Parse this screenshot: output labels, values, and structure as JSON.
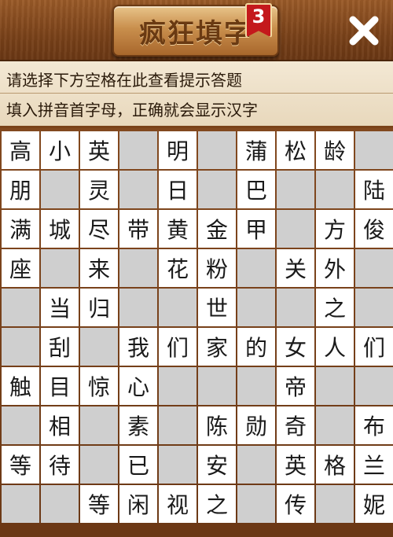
{
  "header": {
    "title": "疯狂填字",
    "level": "3",
    "close_icon": "close-icon"
  },
  "hints": {
    "line1": "请选择下方空格在此查看提示答题",
    "line2": "填入拼音首字母，正确就会显示汉字"
  },
  "grid": {
    "rows": [
      [
        "高",
        "小",
        "英",
        "#",
        "明",
        "#",
        "蒲",
        "松",
        "龄",
        "#"
      ],
      [
        "朋",
        "#",
        "灵",
        "#",
        "日",
        "#",
        "巴",
        "#",
        "#",
        "陆"
      ],
      [
        "满",
        "城",
        "尽",
        "带",
        "黄",
        "金",
        "甲",
        "#",
        "方",
        "俊"
      ],
      [
        "座",
        "#",
        "来",
        "#",
        "花",
        "粉",
        "#",
        "关",
        "外",
        "#"
      ],
      [
        "#",
        "当",
        "归",
        "#",
        "#",
        "世",
        "#",
        "#",
        "之",
        "#"
      ],
      [
        "#",
        "刮",
        "#",
        "我",
        "们",
        "家",
        "的",
        "女",
        "人",
        "们"
      ],
      [
        "触",
        "目",
        "惊",
        "心",
        "#",
        "#",
        "#",
        "帝",
        "#",
        "#"
      ],
      [
        "#",
        "相",
        "#",
        "素",
        "#",
        "陈",
        "勋",
        "奇",
        "#",
        "布"
      ],
      [
        "等",
        "待",
        "#",
        "已",
        "#",
        "安",
        "#",
        "英",
        "格",
        "兰"
      ],
      [
        "#",
        "#",
        "等",
        "闲",
        "视",
        "之",
        "#",
        "传",
        "#",
        "妮"
      ]
    ]
  }
}
